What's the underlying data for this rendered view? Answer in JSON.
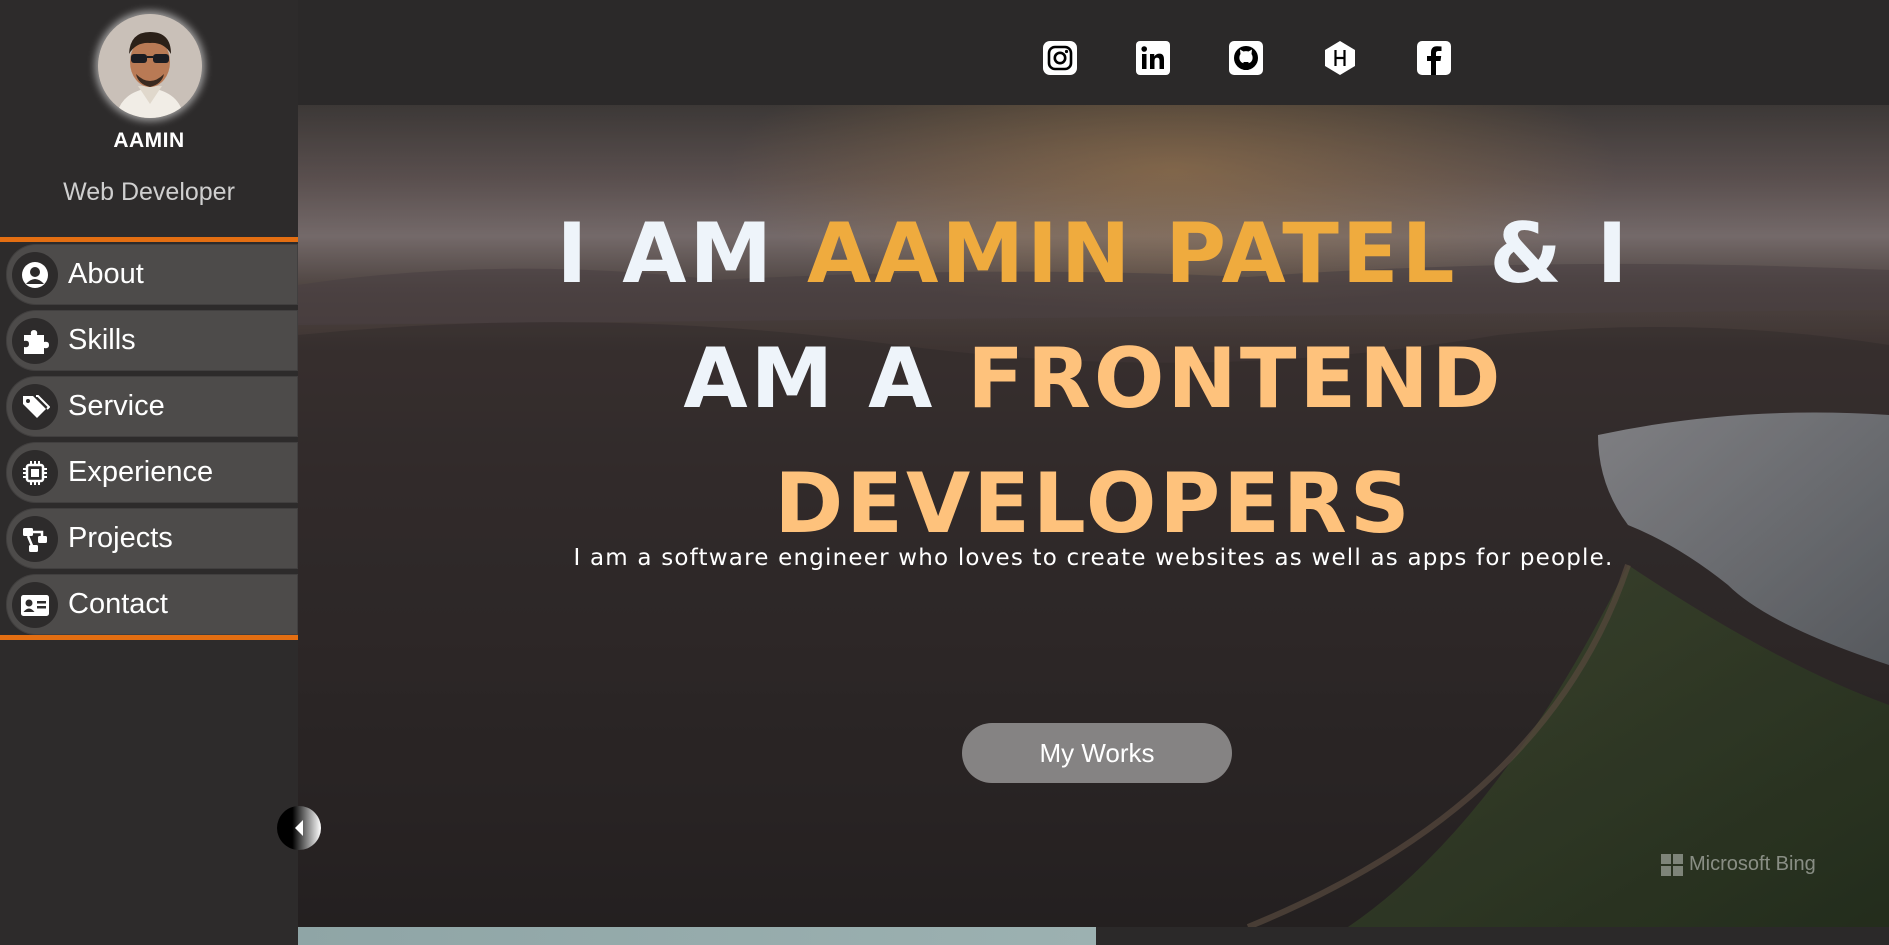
{
  "profile": {
    "name": "AAMIN",
    "role": "Web Developer"
  },
  "sidebar": {
    "items": [
      {
        "label": "About",
        "icon": "user-circle-icon"
      },
      {
        "label": "Skills",
        "icon": "puzzle-icon"
      },
      {
        "label": "Service",
        "icon": "tags-icon"
      },
      {
        "label": "Experience",
        "icon": "chip-icon"
      },
      {
        "label": "Projects",
        "icon": "diagram-icon"
      },
      {
        "label": "Contact",
        "icon": "address-card-icon"
      }
    ]
  },
  "social": [
    "instagram-icon",
    "linkedin-icon",
    "github-icon",
    "hashnode-icon",
    "facebook-icon"
  ],
  "hero": {
    "line1_white_a": "I AM ",
    "line1_orange": "AAMIN PATEL",
    "line1_white_b": " & I",
    "line2_white": "AM A ",
    "line2_orange": "FRONTEND",
    "line3_orange": "DEVELOPERS",
    "subtitle": "I am a software engineer who loves to create websites as well as apps for people.",
    "button": "My Works"
  },
  "watermark": "Microsoft Bing",
  "colors": {
    "accent": "#e36e12",
    "title_orange": "#efab3e",
    "title_light_orange": "#fec27c"
  }
}
